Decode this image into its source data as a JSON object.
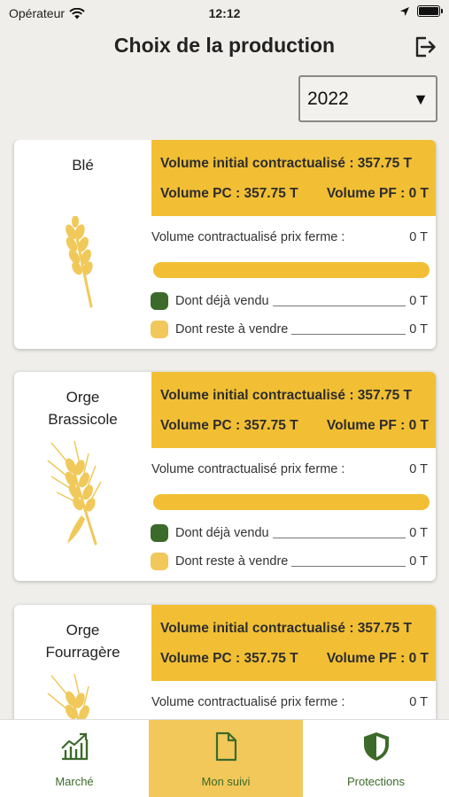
{
  "status_bar": {
    "carrier": "Opérateur",
    "time": "12:12"
  },
  "header": {
    "title": "Choix de la production"
  },
  "year_select": {
    "value": "2022"
  },
  "crops": [
    {
      "name": "Blé",
      "initial_volume": "Volume initial contractualisé : 357.75 T",
      "volume_pc": "Volume PC : 357.75 T",
      "volume_pf": "Volume PF : 0 T",
      "pf_label": "Volume contractualisé prix ferme :",
      "pf_value": "0 T",
      "sold_fraction": 0,
      "sold_label": "Dont déjà vendu",
      "sold_value": "0 T",
      "remaining_label": "Dont reste à vendre",
      "remaining_value": "0 T"
    },
    {
      "name": "Orge\nBrassicole",
      "initial_volume": "Volume initial contractualisé : 357.75 T",
      "volume_pc": "Volume PC : 357.75 T",
      "volume_pf": "Volume PF : 0 T",
      "pf_label": "Volume contractualisé prix ferme :",
      "pf_value": "0 T",
      "sold_fraction": 0,
      "sold_label": "Dont déjà vendu",
      "sold_value": "0 T",
      "remaining_label": "Dont reste à vendre",
      "remaining_value": "0 T"
    },
    {
      "name": "Orge\nFourragère",
      "initial_volume": "Volume initial contractualisé : 357.75 T",
      "volume_pc": "Volume PC : 357.75 T",
      "volume_pf": "Volume PF : 0 T",
      "pf_label": "Volume contractualisé prix ferme :",
      "pf_value": "0 T"
    }
  ],
  "tabs": [
    {
      "label": "Marché",
      "icon": "chart-icon"
    },
    {
      "label": "Mon suivi",
      "icon": "document-icon",
      "active": true
    },
    {
      "label": "Protections",
      "icon": "shield-icon"
    }
  ],
  "colors": {
    "accent": "#f2bf34",
    "green": "#3c6a2a",
    "light_yellow": "#f2c85a"
  }
}
